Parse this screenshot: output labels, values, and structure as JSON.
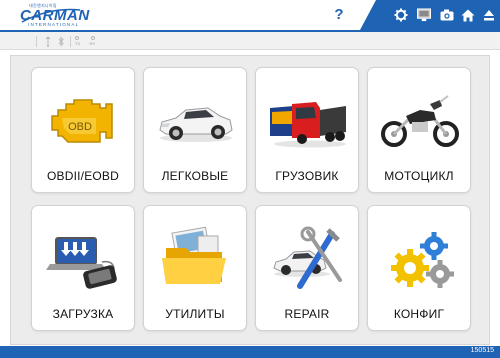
{
  "header": {
    "logo_small": "대진엔지니어링",
    "logo_main": "CARMAN",
    "logo_sub": "INTERNATIONAL",
    "help_label": "?",
    "toolbar_icons": [
      "gear-icon",
      "monitor-icon",
      "camera-icon",
      "home-icon",
      "eject-icon"
    ]
  },
  "statusbar": {
    "icons": [
      "usb-icon",
      "bluetooth-icon",
      "tx-rx-indicator-icon"
    ],
    "tx_label": "TX",
    "rx_label": "RX"
  },
  "tiles": [
    {
      "label": "OBDII/EOBD",
      "icon": "engine-obd-icon",
      "icon_text": "OBD"
    },
    {
      "label": "ЛЕГКОВЫЕ",
      "icon": "passenger-car-icon"
    },
    {
      "label": "ГРУЗОВИК",
      "icon": "truck-icon"
    },
    {
      "label": "МОТОЦИКЛ",
      "icon": "motorcycle-icon"
    },
    {
      "label": "ЗАГРУЗКА",
      "icon": "download-laptop-icon"
    },
    {
      "label": "УТИЛИТЫ",
      "icon": "folder-icon"
    },
    {
      "label": "REPAIR",
      "icon": "repair-tools-icon"
    },
    {
      "label": "КОНФИГ",
      "icon": "gears-icon"
    }
  ],
  "footer": {
    "code": "150515"
  },
  "colors": {
    "brand_blue": "#1f63b4",
    "obd_yellow": "#f2b400",
    "background": "#ececec"
  }
}
